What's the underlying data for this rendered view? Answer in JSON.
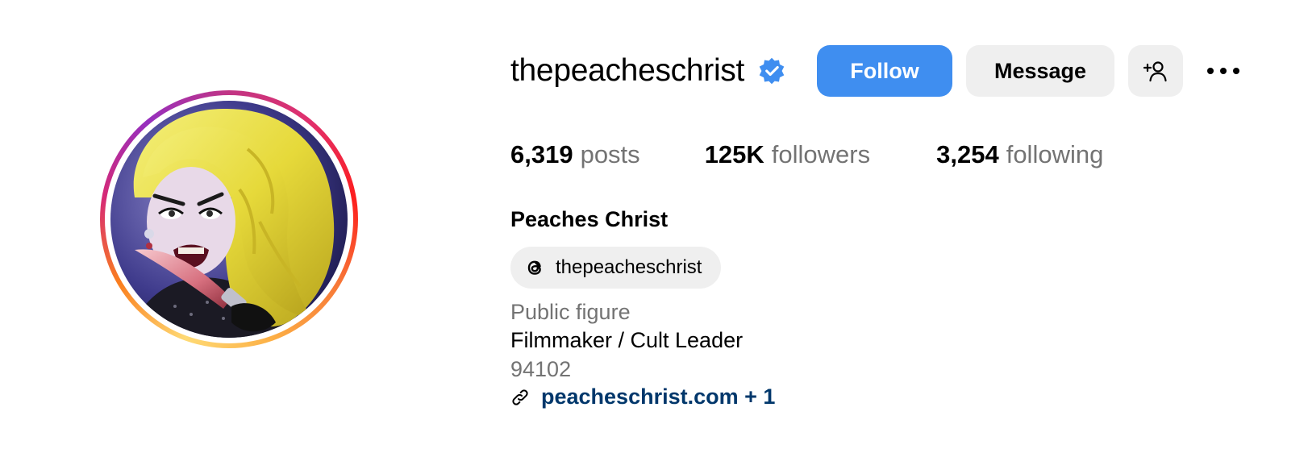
{
  "profile": {
    "username": "thepeacheschrist",
    "verified": true,
    "full_name": "Peaches Christ",
    "category": "Public figure",
    "bio": "Filmmaker / Cult Leader",
    "zip": "94102",
    "link": "peacheschrist.com + 1"
  },
  "actions": {
    "follow_label": "Follow",
    "message_label": "Message"
  },
  "stats": {
    "posts_count": "6,319",
    "posts_label": "posts",
    "followers_count": "125K",
    "followers_label": "followers",
    "following_count": "3,254",
    "following_label": "following"
  },
  "threads": {
    "handle": "thepeacheschrist"
  },
  "icons": {
    "verified": "verified-badge-icon",
    "add_user": "add-user-icon",
    "more": "more-options-icon",
    "threads": "threads-icon",
    "link": "link-icon"
  },
  "colors": {
    "follow_button": "#3f8ef0",
    "secondary_button": "#efefef",
    "muted_text": "#737373",
    "link_text": "#00376b",
    "verified_badge": "#3f8ef0"
  }
}
